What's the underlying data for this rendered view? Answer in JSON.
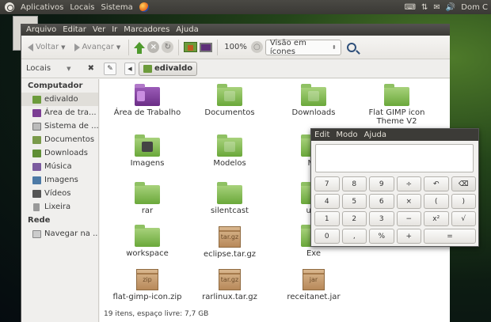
{
  "topbar": {
    "menus": [
      "Aplicativos",
      "Locais",
      "Sistema"
    ],
    "clock": "Dom C"
  },
  "filemanager": {
    "menus": [
      "Arquivo",
      "Editar",
      "Ver",
      "Ir",
      "Marcadores",
      "Ajuda"
    ],
    "toolbar": {
      "back_label": "Voltar",
      "forward_label": "Avançar",
      "zoom": "100%",
      "view_select": "Visão em ícones"
    },
    "location": {
      "pane_label": "Locais",
      "crumb": "edivaldo"
    },
    "sidebar": {
      "section_computer": "Computador",
      "computer_items": [
        {
          "label": "edivaldo",
          "icon": "home-folder-icon"
        },
        {
          "label": "Área de tra...",
          "icon": "desktop-folder-icon"
        },
        {
          "label": "Sistema de ...",
          "icon": "filesystem-icon"
        },
        {
          "label": "Documentos",
          "icon": "documents-folder-icon"
        },
        {
          "label": "Downloads",
          "icon": "downloads-folder-icon"
        },
        {
          "label": "Música",
          "icon": "music-folder-icon"
        },
        {
          "label": "Imagens",
          "icon": "pictures-folder-icon"
        },
        {
          "label": "Vídeos",
          "icon": "videos-folder-icon"
        },
        {
          "label": "Lixeira",
          "icon": "trash-icon"
        }
      ],
      "section_network": "Rede",
      "network_items": [
        {
          "label": "Navegar na ...",
          "icon": "network-icon"
        }
      ]
    },
    "files": [
      {
        "name": "Área de Trabalho",
        "kind": "desktop"
      },
      {
        "name": "Documentos",
        "kind": "folder"
      },
      {
        "name": "Downloads",
        "kind": "folder"
      },
      {
        "name": "Flat GIMP icon Theme V2",
        "kind": "folder"
      },
      {
        "name": "Imagens",
        "kind": "images"
      },
      {
        "name": "Modelos",
        "kind": "folder"
      },
      {
        "name": "Mú",
        "kind": "folder"
      },
      {
        "name": "rar",
        "kind": "folder"
      },
      {
        "name": "silentcast",
        "kind": "folder"
      },
      {
        "name": "ubu",
        "kind": "folder"
      },
      {
        "name": "workspace",
        "kind": "folder"
      },
      {
        "name": "eclipse.tar.gz",
        "kind": "archive",
        "badge": "tar.gz"
      },
      {
        "name": "Exe",
        "kind": "folder"
      },
      {
        "name": "flat-gimp-icon.zip",
        "kind": "archive",
        "badge": "zip"
      },
      {
        "name": "rarlinux.tar.gz",
        "kind": "archive",
        "badge": "tar.gz"
      },
      {
        "name": "receitanet.jar",
        "kind": "archive",
        "badge": "jar"
      }
    ],
    "status": "19 itens, espaço livre: 7,7 GB"
  },
  "calculator": {
    "menus": [
      "Edit",
      "Modo",
      "Ajuda"
    ],
    "display": "",
    "keys": [
      "7",
      "8",
      "9",
      "÷",
      "↶",
      "⌫",
      "4",
      "5",
      "6",
      "×",
      "(",
      ")",
      "1",
      "2",
      "3",
      "−",
      "x²",
      "√",
      "0",
      ",",
      "%",
      "+",
      "="
    ]
  }
}
